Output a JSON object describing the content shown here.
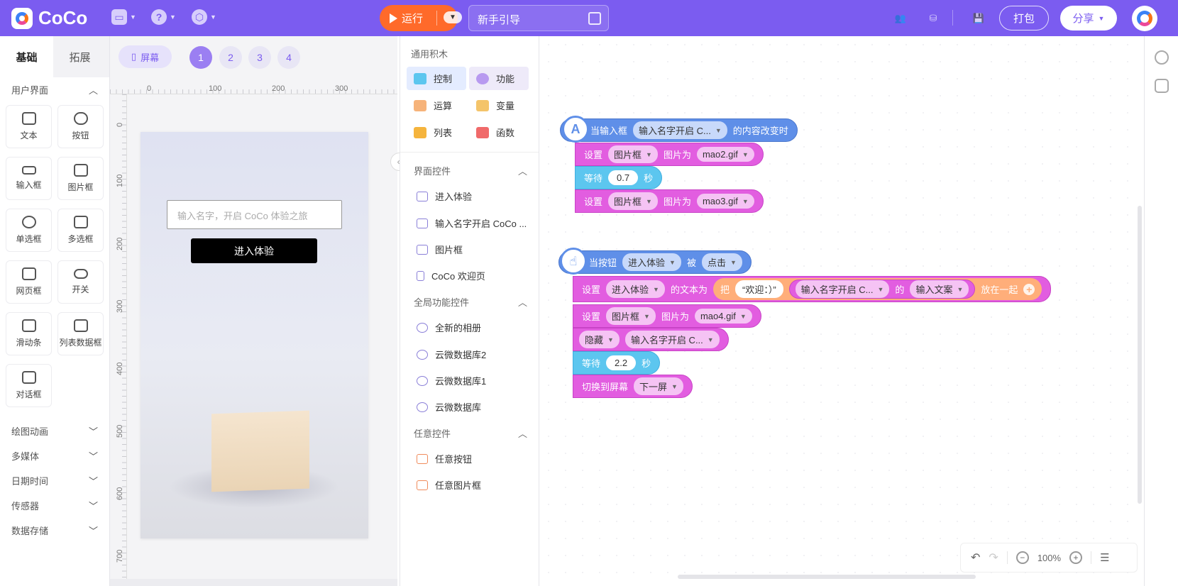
{
  "app": {
    "name": "CoCo"
  },
  "topbar": {
    "run_label": "运行",
    "guide_title": "新手引导",
    "pack_label": "打包",
    "share_label": "分享"
  },
  "left": {
    "tabs": [
      "基础",
      "拓展"
    ],
    "section_ui": "用户界面",
    "components": [
      "文本",
      "按钮",
      "输入框",
      "图片框",
      "单选框",
      "多选框",
      "网页框",
      "开关",
      "滑动条",
      "列表数据框",
      "对话框"
    ],
    "collapsed_sections": [
      "绘图动画",
      "多媒体",
      "日期时间",
      "传感器",
      "数据存储"
    ]
  },
  "stage": {
    "screen_label": "屏幕",
    "pages": [
      "1",
      "2",
      "3",
      "4"
    ],
    "hruler": [
      "0",
      "100",
      "200",
      "300"
    ],
    "vruler": [
      "0",
      "100",
      "200",
      "300",
      "400",
      "500",
      "600",
      "700"
    ],
    "input_placeholder": "输入名字，开启 CoCo 体验之旅",
    "enter_button": "进入体验"
  },
  "palette": {
    "heading": "通用积木",
    "categories": [
      "控制",
      "功能",
      "运算",
      "变量",
      "列表",
      "函数"
    ],
    "sec_ui": "界面控件",
    "ui_items": [
      "进入体验",
      "输入名字开启 CoCo ...",
      "图片框",
      "CoCo 欢迎页"
    ],
    "sec_global": "全局功能控件",
    "global_items": [
      "全新的相册",
      "云微数据库2",
      "云微数据库1",
      "云微数据库"
    ],
    "sec_any": "任意控件",
    "any_items": [
      "任意按钮",
      "任意图片框"
    ]
  },
  "blocks": {
    "g1_hat_pre": "当输入框",
    "g1_hat_dd": "输入名字开启 C...",
    "g1_hat_post": "的内容改变时",
    "set": "设置",
    "imgbox": "图片框",
    "img_to": "图片为",
    "mao2": "mao2.gif",
    "wait": "等待",
    "wait1": "0.7",
    "sec": "秒",
    "mao3": "mao3.gif",
    "g2_hat_pre": "当按钮",
    "g2_hat_dd": "进入体验",
    "g2_hat_mid": "被",
    "g2_hat_dd2": "点击",
    "enter_dd": "进入体验",
    "text_to": "的文本为",
    "ba": "把",
    "welcome": "“欢迎：）”",
    "input_dd": "输入名字开启 C...",
    "de": "的",
    "input_text_dd": "输入文案",
    "join": "放在一起",
    "mao4": "mao4.gif",
    "hide": "隐藏",
    "hide_dd": "输入名字开启 C...",
    "wait2": "2.2",
    "switch": "切换到屏幕",
    "next": "下一屏"
  },
  "zoom": {
    "level": "100%"
  }
}
